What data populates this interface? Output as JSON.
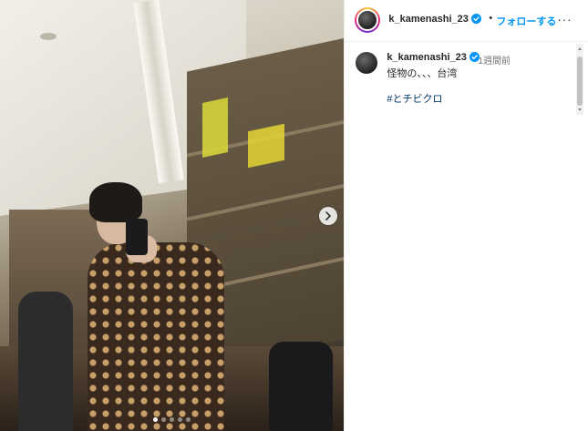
{
  "post": {
    "username": "k_kamenashi_23",
    "follow_label": "フォローする",
    "separator": "•",
    "more_icon": "more-horizontal-icon",
    "verified_icon": "verified-badge-icon"
  },
  "photo": {
    "slide_count": 5,
    "active_slide": 1,
    "next_icon": "chevron-right-icon"
  },
  "caption": {
    "username": "k_kamenashi_23",
    "time_ago": "1週間前",
    "text": "怪物の、、、台湾",
    "hashtag": "#とチビクロ"
  },
  "colors": {
    "accent": "#0095f6",
    "hashtag": "#00376b",
    "verified": "#0095f6"
  }
}
